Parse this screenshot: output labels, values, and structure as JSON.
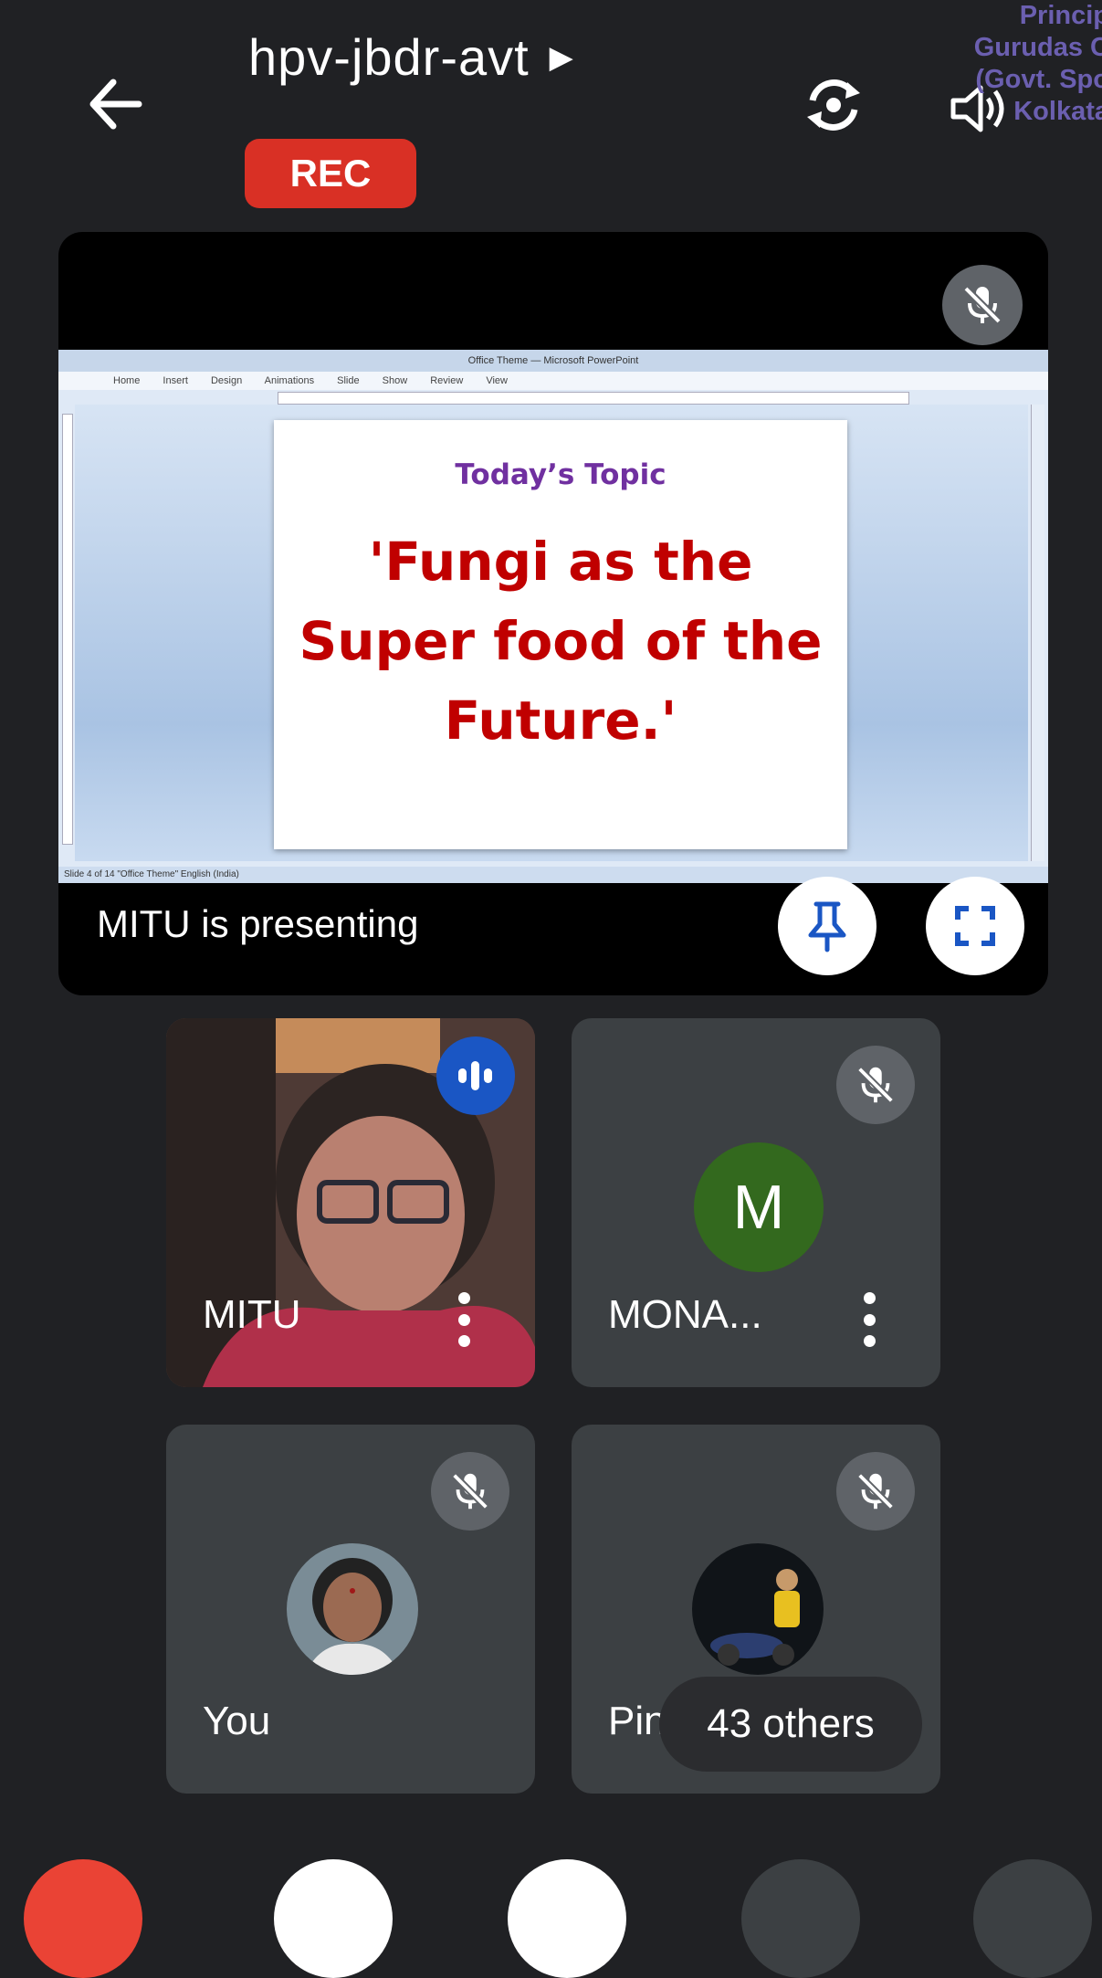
{
  "meeting": {
    "code": "hpv-jbdr-avt",
    "recording_label": "REC"
  },
  "watermark": {
    "lines": [
      "Princip",
      "Gurudas C",
      "(Govt. Spo",
      "Kolkata"
    ]
  },
  "presentation": {
    "presenting_text": "MITU is presenting",
    "app_window_title": "Office Theme — Microsoft PowerPoint",
    "ribbon_tabs": "Home Insert Design Animations Slide Show Review View",
    "status_bar": "Slide 4 of 14   \"Office Theme\"   English (India)",
    "slide": {
      "topic": "Today’s Topic",
      "heading": "'Fungi as the Super food of the Future.'"
    }
  },
  "participants": [
    {
      "name": "MITU",
      "speaking": true
    },
    {
      "name": "MONA...",
      "avatar_letter": "M",
      "muted": true
    },
    {
      "name": "You",
      "muted": true
    },
    {
      "name": "Pintu",
      "muted": true
    }
  ],
  "others_label": "43 others",
  "colors": {
    "background": "#202124",
    "rec": "#d93025",
    "speaking": "#1a56c4",
    "avatar_m": "#33691e",
    "slide_topic": "#7030a0",
    "slide_heading": "#c00000",
    "leave": "#ea4335"
  },
  "icons": [
    "back-arrow-icon",
    "play-triangle-icon",
    "camera-switch-icon",
    "speaker-icon",
    "mic-off-icon",
    "pin-icon",
    "fullscreen-icon",
    "speaking-indicator-icon",
    "more-vert-icon"
  ]
}
